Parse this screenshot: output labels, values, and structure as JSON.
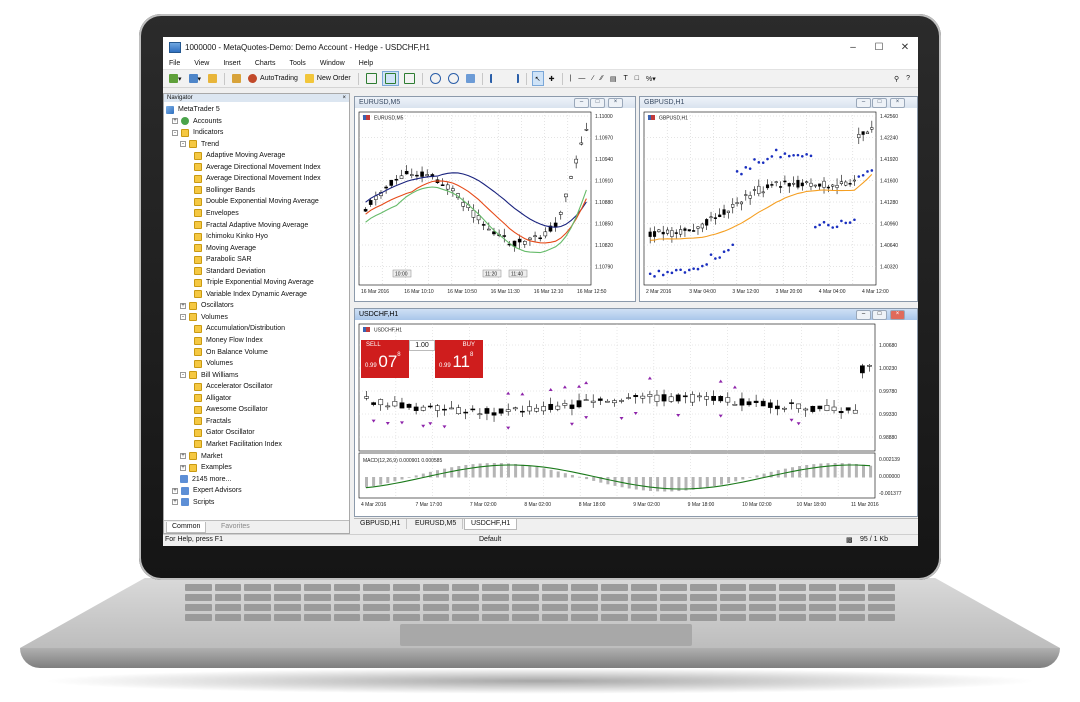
{
  "window": {
    "title": "1000000 - MetaQuotes-Demo: Demo Account - Hedge - USDCHF,H1"
  },
  "menu": [
    "File",
    "View",
    "Insert",
    "Charts",
    "Tools",
    "Window",
    "Help"
  ],
  "toolbar": {
    "autotrading_label": "AutoTrading",
    "new_order_label": "New Order"
  },
  "navigator": {
    "title": "Navigator",
    "root": "MetaTrader 5",
    "accounts": "Accounts",
    "indicators": "Indicators",
    "trend": "Trend",
    "trend_items": [
      "Adaptive Moving Average",
      "Average Directional Movement Index",
      "Average Directional Movement Index",
      "Bollinger Bands",
      "Double Exponential Moving Average",
      "Envelopes",
      "Fractal Adaptive Moving Average",
      "Ichimoku Kinko Hyo",
      "Moving Average",
      "Parabolic SAR",
      "Standard Deviation",
      "Triple Exponential Moving Average",
      "Variable Index Dynamic Average"
    ],
    "oscillators": "Oscillators",
    "volumes": "Volumes",
    "volume_items": [
      "Accumulation/Distribution",
      "Money Flow Index",
      "On Balance Volume",
      "Volumes"
    ],
    "bill_williams": "Bill Williams",
    "bw_items": [
      "Accelerator Oscillator",
      "Alligator",
      "Awesome Oscillator",
      "Fractals",
      "Gator Oscillator",
      "Market Facilitation Index"
    ],
    "market": "Market",
    "examples": "Examples",
    "more": "2145 more...",
    "expert_advisors": "Expert Advisors",
    "scripts": "Scripts",
    "tabs": [
      "Common",
      "Favorites"
    ]
  },
  "charts": {
    "eurusd": {
      "window_title": "EURUSD,M5",
      "symbol_label": "EURUSD,M5",
      "yticks": [
        "1.11000",
        "1.10970",
        "1.10940",
        "1.10910",
        "1.10880",
        "1.10850",
        "1.10820",
        "1.10790"
      ],
      "xticks": [
        "16 Mar 2016",
        "16 Mar 10:10",
        "16 Mar 10:50",
        "16 Mar 11:30",
        "16 Mar 12:10",
        "16 Mar 12:50"
      ],
      "markers": [
        "10:00",
        "11:20",
        "11:40"
      ]
    },
    "gbpusd": {
      "window_title": "GBPUSD,H1",
      "symbol_label": "GBPUSD,H1",
      "yticks": [
        "1.42560",
        "1.42240",
        "1.41920",
        "1.41600",
        "1.41280",
        "1.40960",
        "1.40640",
        "1.40320"
      ],
      "xticks": [
        "2 Mar 2016",
        "3 Mar 04:00",
        "3 Mar 12:00",
        "3 Mar 20:00",
        "4 Mar 04:00",
        "4 Mar 12:00"
      ]
    },
    "usdchf": {
      "window_title": "USDCHF,H1",
      "symbol_label": "USDCHF,H1",
      "yticks": [
        "1.00680",
        "1.00230",
        "0.99780",
        "0.99330",
        "0.98880"
      ],
      "xticks": [
        "4 Mar 2016",
        "7 Mar 17:00",
        "7 Mar 02:00",
        "8 Mar 02:00",
        "8 Mar 18:00",
        "9 Mar 02:00",
        "9 Mar 18:00",
        "10 Mar 02:00",
        "10 Mar 18:00",
        "11 Mar 2016"
      ],
      "macd_label": "MACD(12,26,9) 0.000901 0.000585",
      "macd_yticks": [
        "0.002139",
        "0.000000",
        "-0.001377"
      ]
    }
  },
  "one_click": {
    "sell_label": "SELL",
    "buy_label": "BUY",
    "volume": "1.00",
    "sell_prefix": "0.99",
    "sell_big": "07",
    "sell_sup": "8",
    "buy_prefix": "0.99",
    "buy_big": "11",
    "buy_sup": "8"
  },
  "chart_tabs": [
    "GBPUSD,H1",
    "EURUSD,M5",
    "USDCHF,H1"
  ],
  "status": {
    "help": "For Help, press F1",
    "profile": "Default",
    "traffic": "95 / 1 Kb"
  }
}
